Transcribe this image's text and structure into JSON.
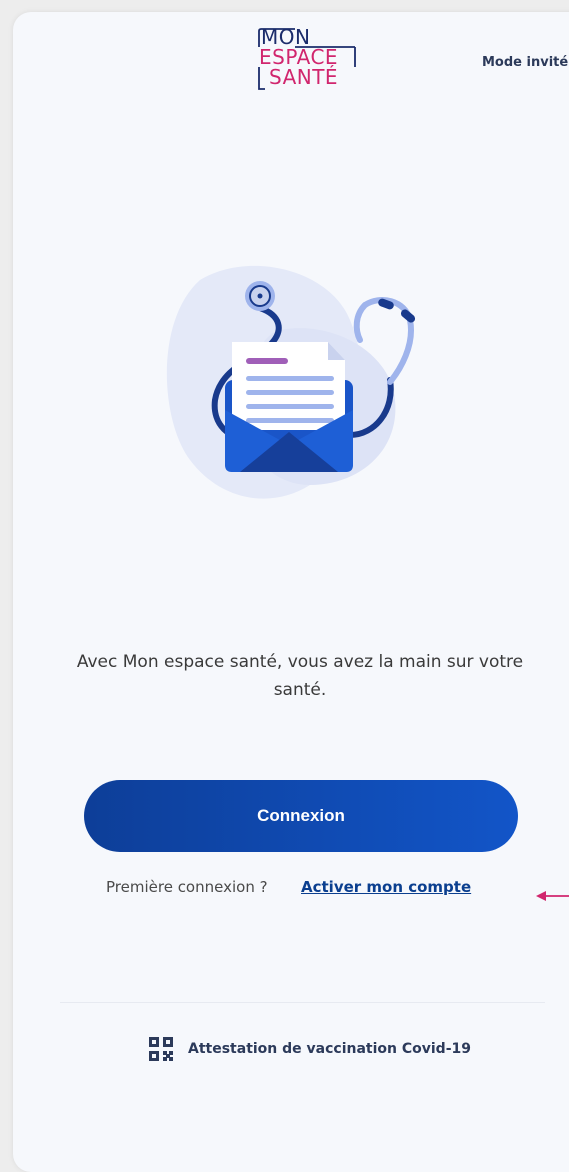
{
  "header": {
    "logo": {
      "line1": "MON",
      "line2": "ESPACE",
      "line3": "SANTÉ"
    },
    "guest_mode_label": "Mode invité"
  },
  "illustration": {
    "icon": "stethoscope-envelope-illustration"
  },
  "main": {
    "tagline": "Avec Mon espace santé, vous avez la main sur votre santé.",
    "login_button_label": "Connexion",
    "first_login_prompt": "Première connexion ?",
    "activate_account_link": "Activer mon compte"
  },
  "footer": {
    "qr_icon": "qr-code-icon",
    "covid_certificate_label": "Attestation de vaccination Covid-19"
  },
  "annotation": {
    "arrow_color": "#d1266e"
  },
  "colors": {
    "brand_navy": "#1b2c6b",
    "brand_pink": "#d1266e",
    "button_start": "#0d3e98",
    "button_end": "#1255c8",
    "link": "#0b3f8f",
    "background": "#f6f8fc"
  }
}
